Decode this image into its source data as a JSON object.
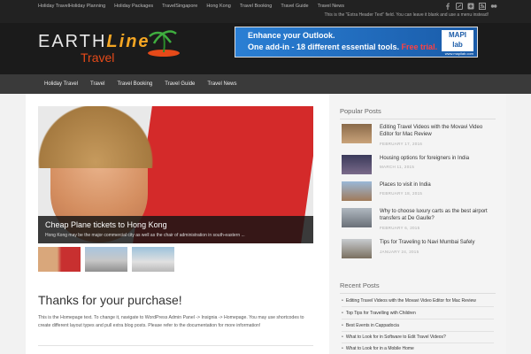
{
  "topbar": {
    "links": [
      "Holiday TravelHoliday Planning",
      "Holiday Packages",
      "TravelSingapore",
      "Hong Kong",
      "Travel Booking",
      "Travel Guide",
      "Travel News"
    ],
    "note": "This is the \"Extra Header Text\" field. You can leave it blank and use a menu instead!",
    "icons": [
      "facebook-icon",
      "twitter-icon",
      "google-plus-icon",
      "rss-icon",
      "flickr-icon"
    ]
  },
  "logo": {
    "part1": "EARTH",
    "part2": "Line",
    "part3": "Travel"
  },
  "banner": {
    "line1": "Enhance your Outlook.",
    "line2": "One add-in - 18 different essential tools.",
    "cta": "Free trial.",
    "brand_top": "MAPI",
    "brand_bottom": "lab",
    "url": "www.mapilab.com"
  },
  "nav": {
    "items": [
      "Holiday Travel",
      "Travel",
      "Travel Booking",
      "Travel Guide",
      "Travel News"
    ]
  },
  "slider": {
    "title": "Cheap Plane tickets to Hong Kong",
    "excerpt": "Hong Kong may be the major commercial city as well as the chair of administration in south-eastern ..."
  },
  "post": {
    "title": "Thanks for your purchase!",
    "text": "This is the Homepage text. To change it, navigate to WordPress Admin Panel -> Insignia -> Homepage. You may use shortcodes to create different layout types and pull extra blog posts. Please refer to the documentation for more information!"
  },
  "sidebar": {
    "popular_title": "Popular Posts",
    "popular": [
      {
        "title": "Editing Travel Videos with the Movavi Video Editor for Mac Review",
        "date": "FEBRUARY 17, 2016"
      },
      {
        "title": "Housing options for foreigners in India",
        "date": "MARCH 11, 2015"
      },
      {
        "title": "Places to visit in India",
        "date": "FEBRUARY 18, 2015"
      },
      {
        "title": "Why to choose luxury carts as the best airport transfers at De Gaulle?",
        "date": "FEBRUARY 6, 2015"
      },
      {
        "title": "Tips for Traveling to Navi Mumbai Safely",
        "date": "JANUARY 24, 2015"
      }
    ],
    "recent_title": "Recent Posts",
    "recent": [
      "Editing Travel Videos with the Movavi Video Editor for Mac Review",
      "Top Tips for Travelling with Children",
      "Best Events in Cappadocia",
      "What to Look for in Software to Edit Travel Videos?",
      "What to Look for in a Mobile Home"
    ]
  }
}
